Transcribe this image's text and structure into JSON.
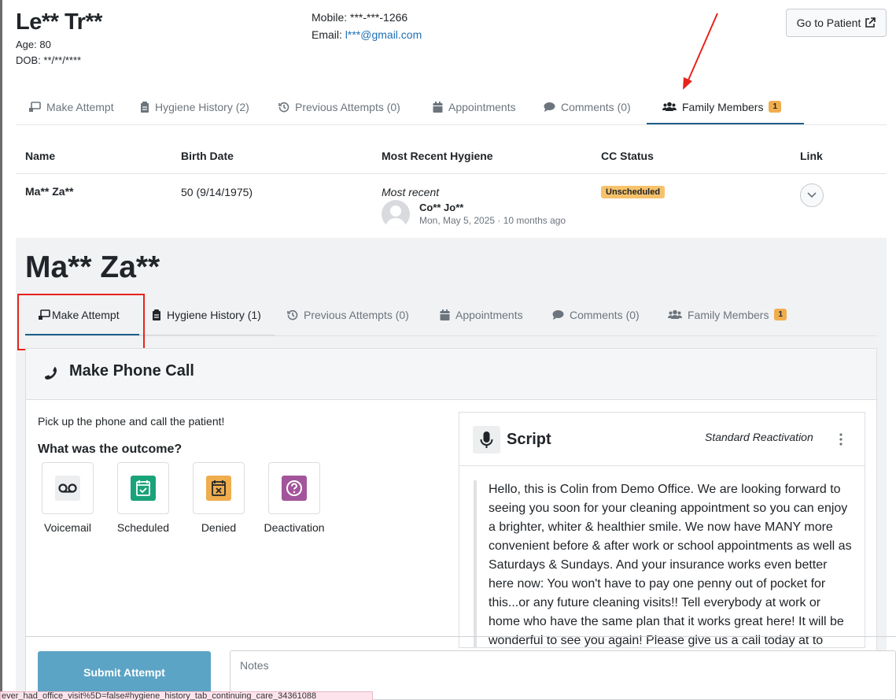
{
  "patient": {
    "name": "Le** Tr**",
    "age": "Age: 80",
    "dob": "DOB: **/**/****",
    "mobile": "Mobile: ***-***-1266",
    "email_label": "Email: ",
    "email": "l***@gmail.com",
    "go_to_patient": "Go to Patient"
  },
  "tabs": [
    {
      "label": "Make Attempt",
      "icon": "phone-desk-icon"
    },
    {
      "label": "Hygiene History (2)",
      "icon": "clipboard-icon"
    },
    {
      "label": "Previous Attempts (0)",
      "icon": "history-icon"
    },
    {
      "label": "Appointments",
      "icon": "calendar-icon"
    },
    {
      "label": "Comments (0)",
      "icon": "comment-icon"
    },
    {
      "label": "Family Members",
      "icon": "users-icon",
      "badge": "1",
      "active": true
    }
  ],
  "family_table": {
    "headers": [
      "Name",
      "Birth Date",
      "Most Recent Hygiene",
      "CC Status",
      "Link"
    ],
    "rows": [
      {
        "name": "Ma** Za**",
        "birth_date": "50 (9/14/1975)",
        "hygiene_label": "Most recent",
        "provider": "Co** Jo**",
        "hygiene_date": "Mon, May 5, 2025 · 10 months ago",
        "cc_status": "Unscheduled"
      }
    ]
  },
  "detail": {
    "name": "Ma** Za**",
    "tabs": [
      {
        "label": "Make Attempt",
        "icon": "phone-desk-icon",
        "active": true
      },
      {
        "label": "Hygiene History (1)",
        "icon": "clipboard-icon"
      },
      {
        "label": "Previous Attempts (0)",
        "icon": "history-icon"
      },
      {
        "label": "Appointments",
        "icon": "calendar-icon"
      },
      {
        "label": "Comments (0)",
        "icon": "comment-icon"
      },
      {
        "label": "Family Members",
        "icon": "users-icon",
        "badge": "1"
      }
    ],
    "card_title": "Make Phone Call",
    "instruction": "Pick up the phone and call the patient!",
    "outcome_question": "What was the outcome?",
    "outcomes": [
      {
        "label": "Voicemail",
        "icon": "voicemail-icon"
      },
      {
        "label": "Scheduled",
        "icon": "calendar-check-icon",
        "color": "#1aa37a"
      },
      {
        "label": "Denied",
        "icon": "calendar-x-icon",
        "color": "#f0ad4e"
      },
      {
        "label": "Deactivation",
        "icon": "question-icon",
        "color": "#a2559a"
      }
    ],
    "script": {
      "title": "Script",
      "type": "Standard Reactivation",
      "text": "Hello, this is Colin from Demo Office. We are looking forward to seeing you soon for your cleaning appointment so you can enjoy a brighter, whiter & healthier smile. We now have MANY more convenient before & after work or school appointments as well as Saturdays & Sundays. And your insurance works even better here now: You won't have to pay one penny out of pocket for this...or any future cleaning visits!! Tell everybody at work or home who have the same plan that it works great here! It will be wonderful to see you again! Please give us a call today at to"
    },
    "submit_label": "Submit Attempt",
    "notes_placeholder": "Notes"
  },
  "status_url": "ever_had_office_visit%5D=false#hygiene_history_tab_continuing_care_34361088",
  "colors": {
    "accent": "#1f5f8b",
    "badge": "#f0ad4e",
    "submit": "#5ba4c5",
    "annotation": "#e8231d"
  }
}
